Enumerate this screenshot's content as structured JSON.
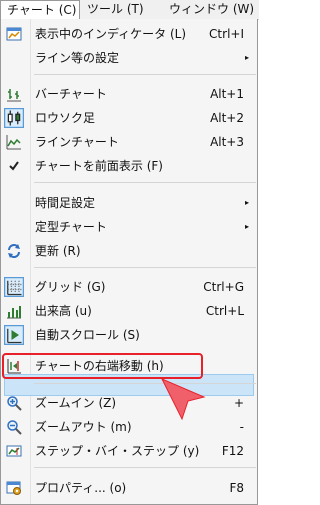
{
  "menubar": {
    "items": [
      {
        "label": "チャート (C)",
        "active": true
      },
      {
        "label": "ツール (T)",
        "active": false
      },
      {
        "label": "ウィンドウ (W)",
        "active": false
      }
    ]
  },
  "menu": {
    "items": [
      {
        "label": "表示中のインディケータ (L)",
        "shortcut": "Ctrl+I",
        "icon": "indicator-list-icon"
      },
      {
        "label": "ライン等の設定",
        "submenu": true
      },
      {
        "label": "バーチャート",
        "shortcut": "Alt+1",
        "icon": "bar-chart-icon"
      },
      {
        "label": "ロウソク足",
        "shortcut": "Alt+2",
        "icon": "candlestick-icon"
      },
      {
        "label": "ラインチャート",
        "shortcut": "Alt+3",
        "icon": "line-chart-icon"
      },
      {
        "label": "チャートを前面表示 (F)",
        "icon": "checkmark-icon"
      },
      {
        "label": "時間足設定",
        "submenu": true
      },
      {
        "label": "定型チャート",
        "submenu": true
      },
      {
        "label": "更新 (R)",
        "icon": "refresh-icon"
      },
      {
        "label": "グリッド (G)",
        "shortcut": "Ctrl+G",
        "icon": "grid-icon"
      },
      {
        "label": "出来高 (u)",
        "shortcut": "Ctrl+L",
        "icon": "volume-icon"
      },
      {
        "label": "自動スクロール (S)",
        "icon": "auto-scroll-icon"
      },
      {
        "label": "チャートの右端移動 (h)",
        "icon": "chart-shift-icon",
        "highlighted": true
      },
      {
        "label": "ズームイン (Z)",
        "shortcut": "+",
        "icon": "zoom-in-icon"
      },
      {
        "label": "ズームアウト (m)",
        "shortcut": "-",
        "icon": "zoom-out-icon"
      },
      {
        "label": "ステップ・バイ・ステップ (y)",
        "shortcut": "F12",
        "icon": "step-by-step-icon"
      },
      {
        "label": "プロパティ... (o)",
        "shortcut": "F8",
        "icon": "properties-icon"
      }
    ],
    "submenu_arrow": "▸"
  },
  "colors": {
    "highlight": "#cbe4f7",
    "annotation": "#e8202a"
  }
}
